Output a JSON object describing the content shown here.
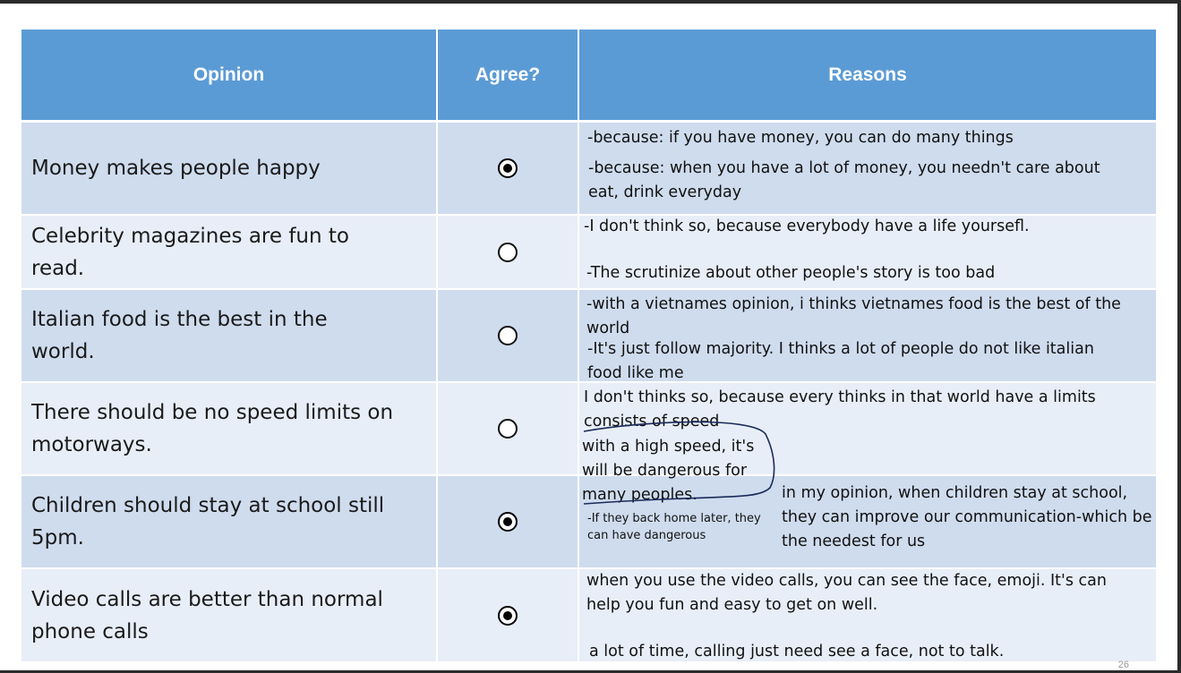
{
  "table": {
    "headers": {
      "opinion": "Opinion",
      "agree": "Agree?",
      "reasons": "Reasons"
    },
    "rows": [
      {
        "opinion": "Money makes people happy",
        "agree": true
      },
      {
        "opinion_l1": "Celebrity magazines are fun to",
        "opinion_l2": "read.",
        "agree": false
      },
      {
        "opinion_l1": "Italian food is the best in the",
        "opinion_l2": "world.",
        "agree": false
      },
      {
        "opinion_l1": "There should be no speed limits on",
        "opinion_l2": "motorways.",
        "agree": false
      },
      {
        "opinion_l1": "Children should stay at school still",
        "opinion_l2": "5pm.",
        "agree": true
      },
      {
        "opinion_l1": "Video calls are better than normal",
        "opinion_l2": "phone calls",
        "agree": true
      }
    ]
  },
  "reasons": {
    "r1a": "-because: if you have money, you can do many things",
    "r1b_l1": "-because: when you have a lot of money, you needn't care about",
    "r1b_l2": "eat, drink everyday",
    "r2a": "-I don't think so, because everybody have a life yoursefl.",
    "r2b": "-The scrutinize about other people's story is too bad",
    "r3a_l1": "-with a vietnames opinion, i thinks vietnames food is the best of the",
    "r3a_l2": "world",
    "r3b_l1": "-It's just follow majority. I thinks a lot of people do not like italian",
    "r3b_l2": "food like me",
    "r4a_l1": "I don't thinks so, because every thinks in that world have a limits",
    "r4a_l2": "consists of speed",
    "r4b_l1": "with a high speed, it's",
    "r4b_l2": "will be dangerous for",
    "r4b_l3": "many peoples.",
    "r5a_l1": "-If they back home later, they",
    "r5a_l2": "can have dangerous",
    "r5b_l1": "in my opinion, when children stay at school,",
    "r5b_l2": "they can improve our communication-which be",
    "r5b_l3": "the needest for us",
    "r6a_l1": "when you use the video calls, you can see the face, emoji. It's can",
    "r6a_l2": "help you fun and easy to get on well.",
    "r6b": "a lot of time, calling just need see a face, not to talk."
  },
  "page_number": "26",
  "colors": {
    "header": "#5b9bd5",
    "row_dark": "#cfdcee",
    "row_light": "#e8eef7"
  }
}
